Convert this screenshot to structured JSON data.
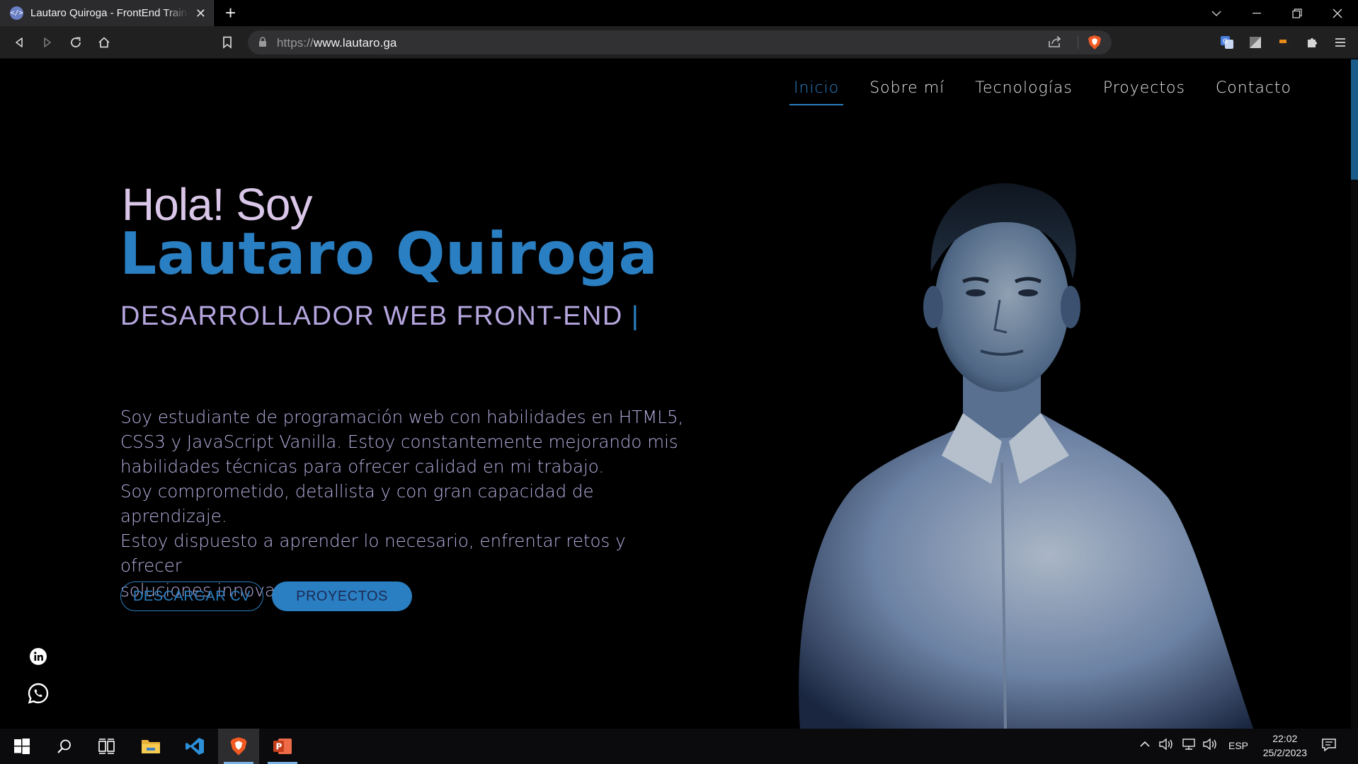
{
  "browser": {
    "tab_title": "Lautaro Quiroga - FrontEnd Trainee",
    "favicon_text": "</>",
    "url_protocol": "https://",
    "url_host": "www.lautaro.ga"
  },
  "nav": {
    "items": [
      "Inicio",
      "Sobre mí",
      "Tecnologías",
      "Proyectos",
      "Contacto"
    ],
    "active": "Inicio"
  },
  "hero": {
    "greeting": "Hola! Soy",
    "name": "Lautaro Quiroga",
    "role": "DESARROLLADOR WEB FRONT-END",
    "cursor": "|",
    "bio_lines": [
      "Soy estudiante de programación web con habilidades en HTML5,",
      "CSS3 y JavaScript Vanilla. Estoy constantemente mejorando mis",
      "habilidades técnicas para ofrecer calidad en mi trabajo.",
      "Soy comprometido, detallista y con gran capacidad de aprendizaje.",
      "Estoy dispuesto a aprender lo necesario, enfrentar retos y ofrecer",
      "soluciones innovadoras."
    ],
    "cv_button": "DESCARGAR CV",
    "projects_button": "PROYECTOS"
  },
  "social": [
    "linkedin-icon",
    "whatsapp-icon"
  ],
  "taskbar": {
    "apps": [
      "start-icon",
      "search-icon",
      "task-view-icon",
      "file-explorer-icon",
      "vscode-icon",
      "brave-icon",
      "powerpoint-icon"
    ],
    "language": "ESP",
    "time": "22:02",
    "date": "25/2/2023"
  },
  "colors": {
    "accent": "#2a7fc2",
    "text_light": "#b9aee0",
    "greeting": "#d9c6e8",
    "background": "#000000"
  }
}
